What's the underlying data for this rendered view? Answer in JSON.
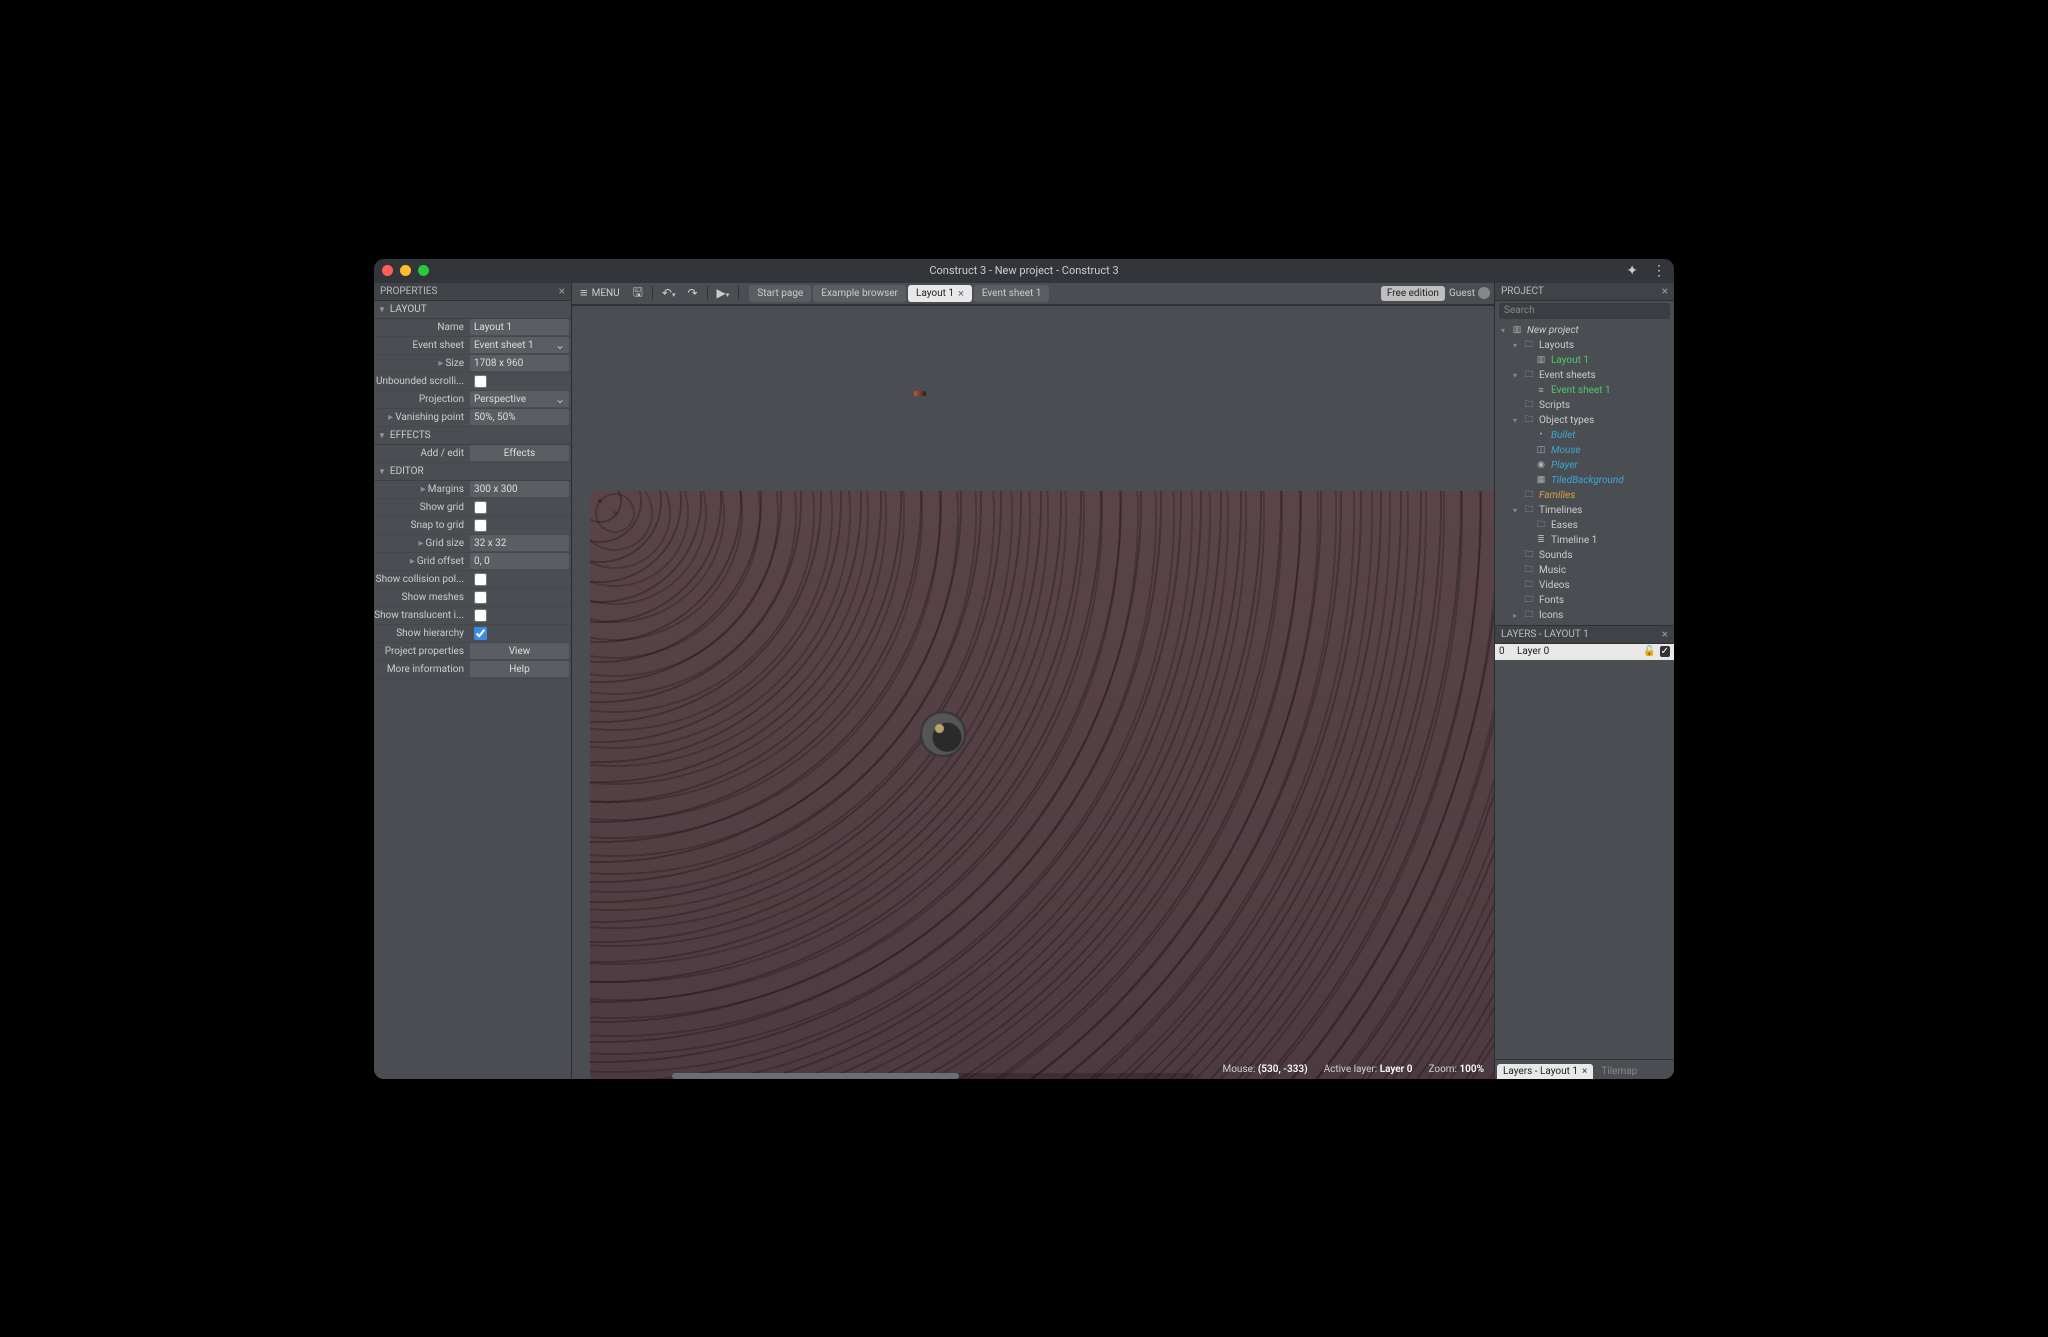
{
  "titlebar": {
    "title": "Construct 3 - New project - Construct 3"
  },
  "toolbar": {
    "menu_label": "MENU",
    "tabs": [
      {
        "label": "Start page"
      },
      {
        "label": "Example browser"
      },
      {
        "label": "Layout 1",
        "active": true,
        "closable": true
      },
      {
        "label": "Event sheet 1"
      }
    ],
    "free_edition": "Free edition",
    "guest": "Guest"
  },
  "properties": {
    "panel_title": "PROPERTIES",
    "sections": {
      "layout": {
        "title": "LAYOUT",
        "name_label": "Name",
        "name_value": "Layout 1",
        "eventsheet_label": "Event sheet",
        "eventsheet_value": "Event sheet 1",
        "size_label": "Size",
        "size_value": "1708 x 960",
        "unbounded_label": "Unbounded scrolli...",
        "projection_label": "Projection",
        "projection_value": "Perspective",
        "vanishing_label": "Vanishing point",
        "vanishing_value": "50%, 50%"
      },
      "effects": {
        "title": "EFFECTS",
        "addedit_label": "Add / edit",
        "addedit_btn": "Effects"
      },
      "editor": {
        "title": "EDITOR",
        "margins_label": "Margins",
        "margins_value": "300 x 300",
        "showgrid_label": "Show grid",
        "snap_label": "Snap to grid",
        "gridsize_label": "Grid size",
        "gridsize_value": "32 x 32",
        "gridoffset_label": "Grid offset",
        "gridoffset_value": "0, 0",
        "collision_label": "Show collision pol...",
        "meshes_label": "Show meshes",
        "translucent_label": "Show translucent i...",
        "hierarchy_label": "Show hierarchy",
        "projprops_label": "Project properties",
        "projprops_btn": "View",
        "moreinfo_label": "More information",
        "moreinfo_btn": "Help"
      }
    }
  },
  "status": {
    "mouse_label": "Mouse:",
    "mouse_value": "(530, -333)",
    "layer_label": "Active layer:",
    "layer_value": "Layer 0",
    "zoom_label": "Zoom:",
    "zoom_value": "100%"
  },
  "project": {
    "panel_title": "PROJECT",
    "search_placeholder": "Search",
    "tree": [
      {
        "d": 0,
        "exp": "▾",
        "icn": "▥",
        "label": "New project",
        "cls": "italic"
      },
      {
        "d": 1,
        "exp": "▾",
        "icn": "🗀",
        "label": "Layouts"
      },
      {
        "d": 2,
        "exp": " ",
        "icn": "▥",
        "label": "Layout 1",
        "cls": "green"
      },
      {
        "d": 1,
        "exp": "▾",
        "icn": "🗀",
        "label": "Event sheets"
      },
      {
        "d": 2,
        "exp": " ",
        "icn": "≡",
        "label": "Event sheet 1",
        "cls": "green"
      },
      {
        "d": 1,
        "exp": " ",
        "icn": "🗀",
        "label": "Scripts"
      },
      {
        "d": 1,
        "exp": "▾",
        "icn": "🗀",
        "label": "Object types"
      },
      {
        "d": 2,
        "exp": " ",
        "icn": "•",
        "label": "Bullet",
        "cls": "blue"
      },
      {
        "d": 2,
        "exp": " ",
        "icn": "◫",
        "label": "Mouse",
        "cls": "blue"
      },
      {
        "d": 2,
        "exp": " ",
        "icn": "◉",
        "label": "Player",
        "cls": "blue"
      },
      {
        "d": 2,
        "exp": " ",
        "icn": "▦",
        "label": "TiledBackground",
        "cls": "blue"
      },
      {
        "d": 1,
        "exp": " ",
        "icn": "🗀",
        "label": "Families",
        "cls": "orange"
      },
      {
        "d": 1,
        "exp": "▾",
        "icn": "🗀",
        "label": "Timelines"
      },
      {
        "d": 2,
        "exp": " ",
        "icn": "🗀",
        "label": "Eases"
      },
      {
        "d": 2,
        "exp": " ",
        "icn": "≣",
        "label": "Timeline 1"
      },
      {
        "d": 1,
        "exp": " ",
        "icn": "🗀",
        "label": "Sounds"
      },
      {
        "d": 1,
        "exp": " ",
        "icn": "🗀",
        "label": "Music"
      },
      {
        "d": 1,
        "exp": " ",
        "icn": "🗀",
        "label": "Videos"
      },
      {
        "d": 1,
        "exp": " ",
        "icn": "🗀",
        "label": "Fonts"
      },
      {
        "d": 1,
        "exp": "▸",
        "icn": "🗀",
        "label": "Icons"
      }
    ]
  },
  "layers": {
    "panel_title": "LAYERS - LAYOUT 1",
    "row": {
      "index": "0",
      "name": "Layer 0"
    },
    "bottom_tabs": {
      "active": "Layers - Layout 1",
      "inactive": "Tilemap"
    }
  }
}
